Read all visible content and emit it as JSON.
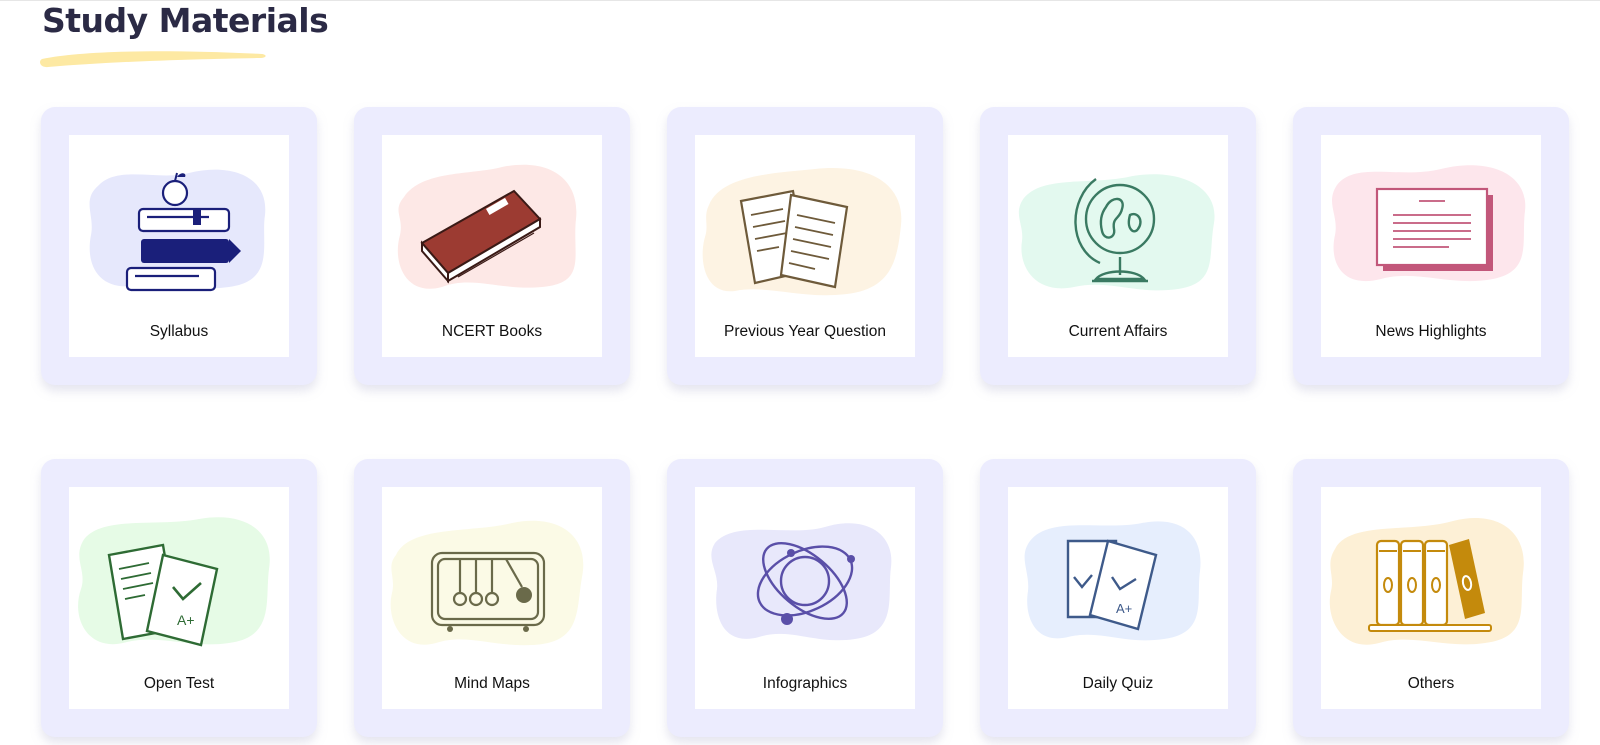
{
  "header": {
    "title": "Study Materials",
    "accent_color": "#fde9a3"
  },
  "cards": [
    {
      "label": "Syllabus",
      "icon": "stacked-books-apple-icon",
      "blob_color": "#e6e8fc",
      "ink_color": "#1a1f7a"
    },
    {
      "label": "NCERT Books",
      "icon": "closed-book-icon",
      "blob_color": "#fde8e6",
      "ink_color": "#9c3b32"
    },
    {
      "label": "Previous Year Question",
      "icon": "question-papers-icon",
      "blob_color": "#fdf3e3",
      "ink_color": "#6e5a3a"
    },
    {
      "label": "Current Affairs",
      "icon": "globe-icon",
      "blob_color": "#e3f9ef",
      "ink_color": "#3a7a62"
    },
    {
      "label": "News Highlights",
      "icon": "newspaper-icon",
      "blob_color": "#fde6ec",
      "ink_color": "#c2577a"
    },
    {
      "label": "Open Test",
      "icon": "test-papers-icon",
      "blob_color": "#e6fbe6",
      "ink_color": "#2e6b34"
    },
    {
      "label": "Mind Maps",
      "icon": "newtons-cradle-icon",
      "blob_color": "#fbfae6",
      "ink_color": "#6a6a4a"
    },
    {
      "label": "Infographics",
      "icon": "atom-icon",
      "blob_color": "#e8e8fb",
      "ink_color": "#5a4fa8"
    },
    {
      "label": "Daily Quiz",
      "icon": "quiz-cards-icon",
      "blob_color": "#e6eefd",
      "ink_color": "#3e5a8a"
    },
    {
      "label": "Others",
      "icon": "bookshelf-icon",
      "blob_color": "#fdf0d6",
      "ink_color": "#c48a0c"
    }
  ]
}
